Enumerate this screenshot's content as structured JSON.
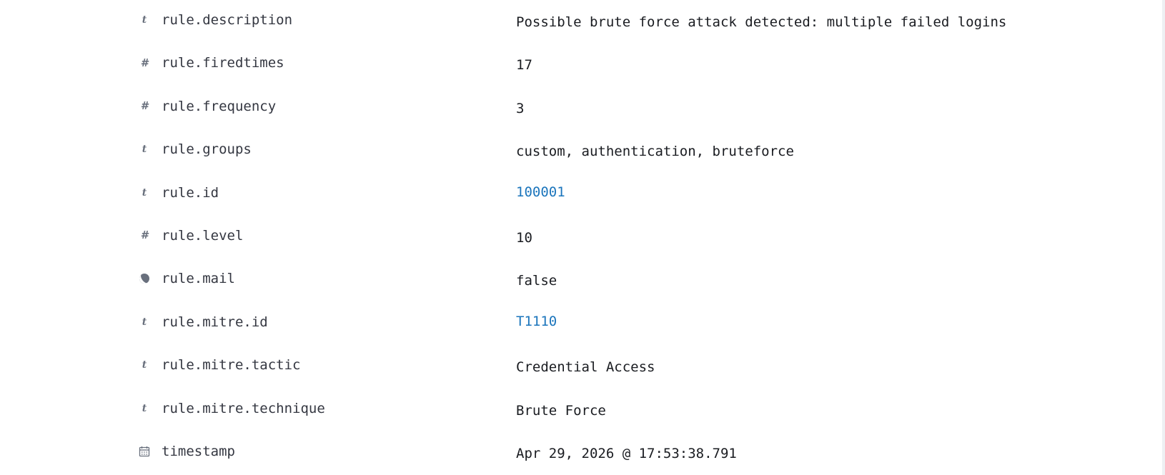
{
  "fields": [
    {
      "type_icon": "text-type-icon",
      "type_glyph": "t",
      "name": "rule.description",
      "value": "Possible brute force attack detected: multiple failed logins",
      "link": false
    },
    {
      "type_icon": "number-type-icon",
      "type_glyph": "#",
      "name": "rule.firedtimes",
      "value": "17",
      "link": false
    },
    {
      "type_icon": "number-type-icon",
      "type_glyph": "#",
      "name": "rule.frequency",
      "value": "3",
      "link": false
    },
    {
      "type_icon": "text-type-icon",
      "type_glyph": "t",
      "name": "rule.groups",
      "value": "custom, authentication, bruteforce",
      "link": false
    },
    {
      "type_icon": "text-type-icon",
      "type_glyph": "t",
      "name": "rule.id",
      "value": "100001",
      "link": true
    },
    {
      "type_icon": "number-type-icon",
      "type_glyph": "#",
      "name": "rule.level",
      "value": "10",
      "link": false
    },
    {
      "type_icon": "boolean-type-icon",
      "type_glyph": "",
      "name": "rule.mail",
      "value": "false",
      "link": false
    },
    {
      "type_icon": "text-type-icon",
      "type_glyph": "t",
      "name": "rule.mitre.id",
      "value": "T1110",
      "link": true
    },
    {
      "type_icon": "text-type-icon",
      "type_glyph": "t",
      "name": "rule.mitre.tactic",
      "value": "Credential Access",
      "link": false
    },
    {
      "type_icon": "text-type-icon",
      "type_glyph": "t",
      "name": "rule.mitre.technique",
      "value": "Brute Force",
      "link": false
    },
    {
      "type_icon": "date-type-icon",
      "type_glyph": "",
      "name": "timestamp",
      "value": "Apr 29, 2026 @ 17:53:38.791",
      "link": false
    }
  ],
  "colors": {
    "link": "#1b75bc",
    "icon": "#69707d",
    "text": "#1a1c21"
  }
}
